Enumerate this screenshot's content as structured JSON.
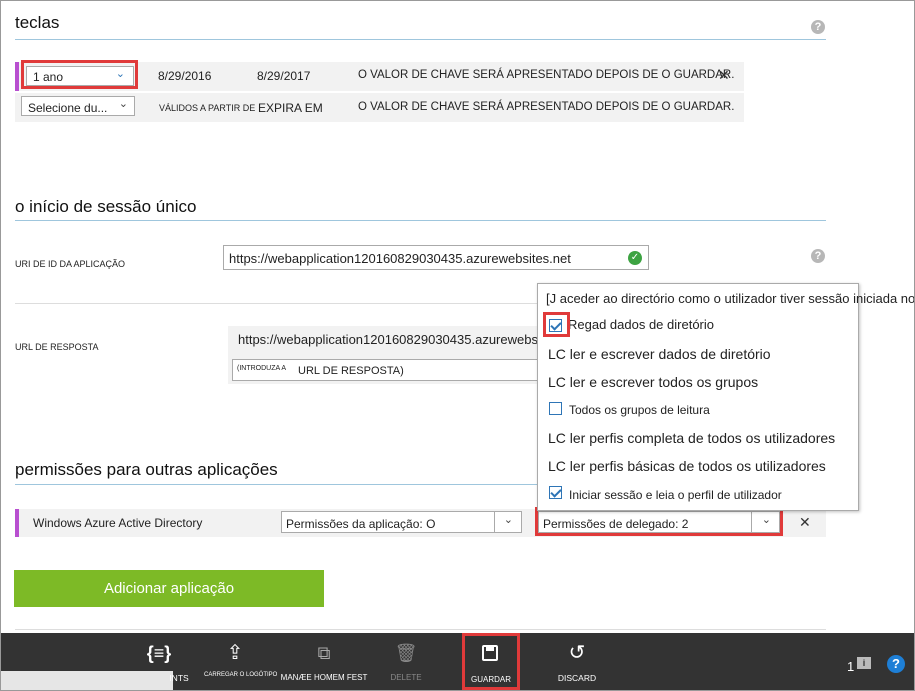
{
  "keys": {
    "heading": "teclas",
    "help": "?",
    "row1": {
      "duration": "1 ano",
      "valid_from": "8/29/2016",
      "expires": "8/29/2017",
      "value": "O VALOR DE CHAVE SERÁ APRESENTADO DEPOIS DE O GUARDAR.",
      "remove": "✕"
    },
    "row2": {
      "duration": "Selecione du...",
      "valid_from": "VÁLIDOS A PARTIR DE",
      "expires": "EXPIRA EM",
      "value": "O VALOR DE CHAVE SERÁ APRESENTADO DEPOIS DE O GUARDAR."
    }
  },
  "sso": {
    "heading": "o início de sessão único",
    "app_id_label": "URI DE ID DA APLICAÇÃO",
    "app_id_value": "https://webapplication120160829030435.azurewebsites.net",
    "help": "?",
    "reply_label": "URL DE RESPOSTA",
    "reply_value": "https://webapplication120160829030435.azurewebsit",
    "reply_hint_small": "(INTRODUZA A",
    "reply_hint": "URL DE RESPOSTA)"
  },
  "permissions_popup": {
    "items": [
      {
        "label": "[J aceder ao directório como o utilizador tiver sessão iniciada no",
        "checkbox": false
      },
      {
        "label": "Regad dados de diretório",
        "checkbox": true,
        "checked": true
      },
      {
        "label": "LC ler e escrever dados de diretório",
        "checkbox": false
      },
      {
        "label": "LC ler e escrever todos os grupos",
        "checkbox": false
      },
      {
        "label": "Todos os grupos de leitura",
        "checkbox": true,
        "checked": false
      },
      {
        "label": "LC ler perfis completa de todos os utilizadores",
        "checkbox": false
      },
      {
        "label": "LC ler perfis básicas de todos os utilizadores",
        "checkbox": false
      },
      {
        "label": "Iniciar sessão e leia o perfil de utilizador",
        "checkbox": true,
        "checked": true
      }
    ]
  },
  "other_apps": {
    "heading": "permissões para outras aplicações",
    "app_name": "Windows Azure Active Directory",
    "app_permissions": "Permissões da aplicação: O",
    "delegated_permissions": "Permissões de delegado: 2",
    "remove": "✕",
    "add_button": "Adicionar aplicação"
  },
  "commandbar": {
    "endpoints": "INTS",
    "upload_logo": "CARREGAR O LOGÓTIPO",
    "manage_manifest": "MANÆE HOMEM FEST",
    "delete": "DELETE",
    "save": "GUARDAR",
    "discard": "DISCARD",
    "notifications_count": "1",
    "help": "?"
  }
}
